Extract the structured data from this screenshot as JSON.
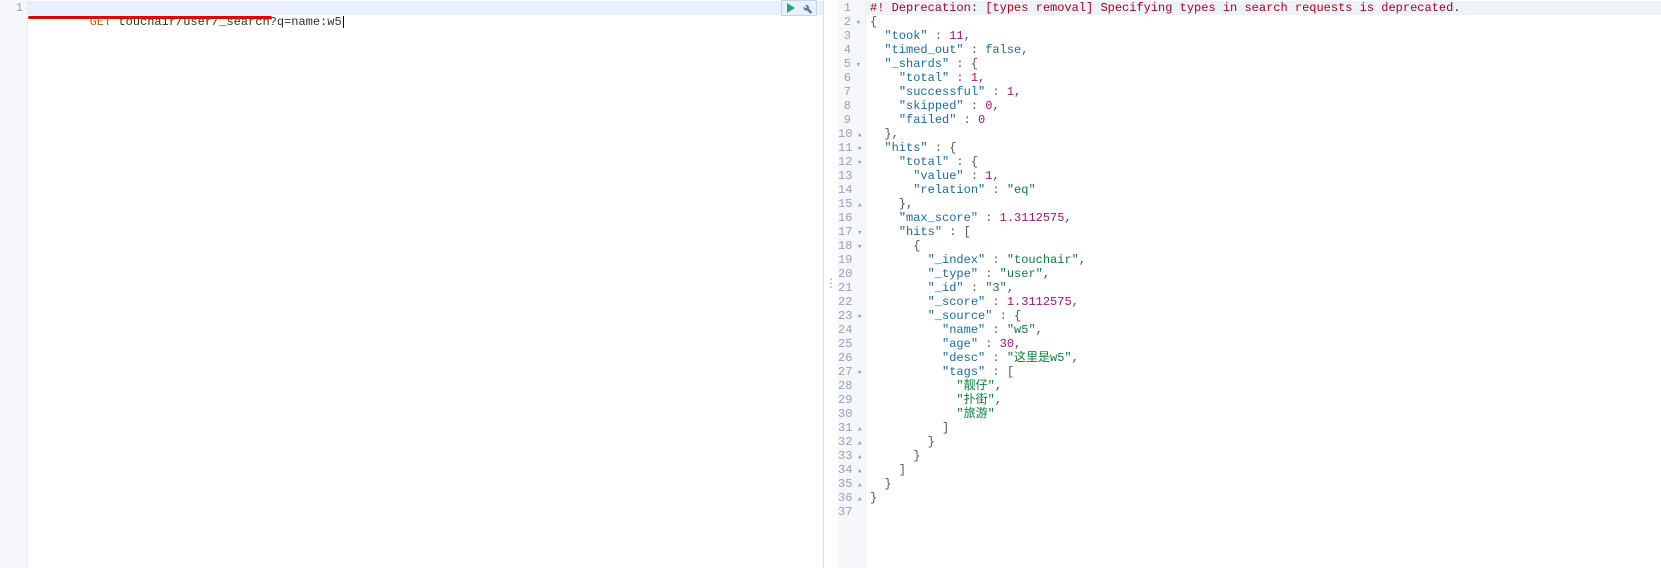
{
  "left": {
    "line_nums": [
      "1"
    ],
    "method": "GET",
    "path": " touchair/user/_search?q=name:w5"
  },
  "divider": "⋮",
  "right": {
    "gutter": [
      {
        "n": "1",
        "f": ""
      },
      {
        "n": "2",
        "f": "▾"
      },
      {
        "n": "3",
        "f": ""
      },
      {
        "n": "4",
        "f": ""
      },
      {
        "n": "5",
        "f": "▾"
      },
      {
        "n": "6",
        "f": ""
      },
      {
        "n": "7",
        "f": ""
      },
      {
        "n": "8",
        "f": ""
      },
      {
        "n": "9",
        "f": ""
      },
      {
        "n": "10",
        "f": "▴"
      },
      {
        "n": "11",
        "f": "▾"
      },
      {
        "n": "12",
        "f": "▾"
      },
      {
        "n": "13",
        "f": ""
      },
      {
        "n": "14",
        "f": ""
      },
      {
        "n": "15",
        "f": "▴"
      },
      {
        "n": "16",
        "f": ""
      },
      {
        "n": "17",
        "f": "▾"
      },
      {
        "n": "18",
        "f": "▾"
      },
      {
        "n": "19",
        "f": ""
      },
      {
        "n": "20",
        "f": ""
      },
      {
        "n": "21",
        "f": ""
      },
      {
        "n": "22",
        "f": ""
      },
      {
        "n": "23",
        "f": "▾"
      },
      {
        "n": "24",
        "f": ""
      },
      {
        "n": "25",
        "f": ""
      },
      {
        "n": "26",
        "f": ""
      },
      {
        "n": "27",
        "f": "▾"
      },
      {
        "n": "28",
        "f": ""
      },
      {
        "n": "29",
        "f": ""
      },
      {
        "n": "30",
        "f": ""
      },
      {
        "n": "31",
        "f": "▴"
      },
      {
        "n": "32",
        "f": "▴"
      },
      {
        "n": "33",
        "f": "▴"
      },
      {
        "n": "34",
        "f": "▴"
      },
      {
        "n": "35",
        "f": "▴"
      },
      {
        "n": "36",
        "f": "▴"
      },
      {
        "n": "37",
        "f": ""
      }
    ],
    "lines": [
      [
        {
          "t": "#! Deprecation: [types removal] Specifying types in search requests is deprecated.",
          "c": "tk-err"
        }
      ],
      [
        {
          "t": "{",
          "c": "tk-punc"
        }
      ],
      [
        {
          "t": "  ",
          "c": ""
        },
        {
          "t": "\"took\"",
          "c": "tk-key"
        },
        {
          "t": " : ",
          "c": "tk-punc"
        },
        {
          "t": "11",
          "c": "tk-num"
        },
        {
          "t": ",",
          "c": "tk-punc"
        }
      ],
      [
        {
          "t": "  ",
          "c": ""
        },
        {
          "t": "\"timed_out\"",
          "c": "tk-key"
        },
        {
          "t": " : ",
          "c": "tk-punc"
        },
        {
          "t": "false",
          "c": "tk-bool"
        },
        {
          "t": ",",
          "c": "tk-punc"
        }
      ],
      [
        {
          "t": "  ",
          "c": ""
        },
        {
          "t": "\"_shards\"",
          "c": "tk-key"
        },
        {
          "t": " : {",
          "c": "tk-punc"
        }
      ],
      [
        {
          "t": "    ",
          "c": ""
        },
        {
          "t": "\"total\"",
          "c": "tk-key"
        },
        {
          "t": " : ",
          "c": "tk-punc"
        },
        {
          "t": "1",
          "c": "tk-num"
        },
        {
          "t": ",",
          "c": "tk-punc"
        }
      ],
      [
        {
          "t": "    ",
          "c": ""
        },
        {
          "t": "\"successful\"",
          "c": "tk-key"
        },
        {
          "t": " : ",
          "c": "tk-punc"
        },
        {
          "t": "1",
          "c": "tk-num"
        },
        {
          "t": ",",
          "c": "tk-punc"
        }
      ],
      [
        {
          "t": "    ",
          "c": ""
        },
        {
          "t": "\"skipped\"",
          "c": "tk-key"
        },
        {
          "t": " : ",
          "c": "tk-punc"
        },
        {
          "t": "0",
          "c": "tk-num"
        },
        {
          "t": ",",
          "c": "tk-punc"
        }
      ],
      [
        {
          "t": "    ",
          "c": ""
        },
        {
          "t": "\"failed\"",
          "c": "tk-key"
        },
        {
          "t": " : ",
          "c": "tk-punc"
        },
        {
          "t": "0",
          "c": "tk-num"
        }
      ],
      [
        {
          "t": "  },",
          "c": "tk-punc"
        }
      ],
      [
        {
          "t": "  ",
          "c": ""
        },
        {
          "t": "\"hits\"",
          "c": "tk-key"
        },
        {
          "t": " : {",
          "c": "tk-punc"
        }
      ],
      [
        {
          "t": "    ",
          "c": ""
        },
        {
          "t": "\"total\"",
          "c": "tk-key"
        },
        {
          "t": " : {",
          "c": "tk-punc"
        }
      ],
      [
        {
          "t": "      ",
          "c": ""
        },
        {
          "t": "\"value\"",
          "c": "tk-key"
        },
        {
          "t": " : ",
          "c": "tk-punc"
        },
        {
          "t": "1",
          "c": "tk-num"
        },
        {
          "t": ",",
          "c": "tk-punc"
        }
      ],
      [
        {
          "t": "      ",
          "c": ""
        },
        {
          "t": "\"relation\"",
          "c": "tk-key"
        },
        {
          "t": " : ",
          "c": "tk-punc"
        },
        {
          "t": "\"eq\"",
          "c": "tk-str"
        }
      ],
      [
        {
          "t": "    },",
          "c": "tk-punc"
        }
      ],
      [
        {
          "t": "    ",
          "c": ""
        },
        {
          "t": "\"max_score\"",
          "c": "tk-key"
        },
        {
          "t": " : ",
          "c": "tk-punc"
        },
        {
          "t": "1.3112575",
          "c": "tk-num"
        },
        {
          "t": ",",
          "c": "tk-punc"
        }
      ],
      [
        {
          "t": "    ",
          "c": ""
        },
        {
          "t": "\"hits\"",
          "c": "tk-key"
        },
        {
          "t": " : [",
          "c": "tk-punc"
        }
      ],
      [
        {
          "t": "      {",
          "c": "tk-punc"
        }
      ],
      [
        {
          "t": "        ",
          "c": ""
        },
        {
          "t": "\"_index\"",
          "c": "tk-key"
        },
        {
          "t": " : ",
          "c": "tk-punc"
        },
        {
          "t": "\"touchair\"",
          "c": "tk-str"
        },
        {
          "t": ",",
          "c": "tk-punc"
        }
      ],
      [
        {
          "t": "        ",
          "c": ""
        },
        {
          "t": "\"_type\"",
          "c": "tk-key"
        },
        {
          "t": " : ",
          "c": "tk-punc"
        },
        {
          "t": "\"user\"",
          "c": "tk-str"
        },
        {
          "t": ",",
          "c": "tk-punc"
        }
      ],
      [
        {
          "t": "        ",
          "c": ""
        },
        {
          "t": "\"_id\"",
          "c": "tk-key"
        },
        {
          "t": " : ",
          "c": "tk-punc"
        },
        {
          "t": "\"3\"",
          "c": "tk-str"
        },
        {
          "t": ",",
          "c": "tk-punc"
        }
      ],
      [
        {
          "t": "        ",
          "c": ""
        },
        {
          "t": "\"_score\"",
          "c": "tk-key"
        },
        {
          "t": " : ",
          "c": "tk-punc"
        },
        {
          "t": "1.3112575",
          "c": "tk-num"
        },
        {
          "t": ",",
          "c": "tk-punc"
        }
      ],
      [
        {
          "t": "        ",
          "c": ""
        },
        {
          "t": "\"_source\"",
          "c": "tk-key"
        },
        {
          "t": " : {",
          "c": "tk-punc"
        }
      ],
      [
        {
          "t": "          ",
          "c": ""
        },
        {
          "t": "\"name\"",
          "c": "tk-key"
        },
        {
          "t": " : ",
          "c": "tk-punc"
        },
        {
          "t": "\"w5\"",
          "c": "tk-str"
        },
        {
          "t": ",",
          "c": "tk-punc"
        }
      ],
      [
        {
          "t": "          ",
          "c": ""
        },
        {
          "t": "\"age\"",
          "c": "tk-key"
        },
        {
          "t": " : ",
          "c": "tk-punc"
        },
        {
          "t": "30",
          "c": "tk-num"
        },
        {
          "t": ",",
          "c": "tk-punc"
        }
      ],
      [
        {
          "t": "          ",
          "c": ""
        },
        {
          "t": "\"desc\"",
          "c": "tk-key"
        },
        {
          "t": " : ",
          "c": "tk-punc"
        },
        {
          "t": "\"这里是w5\"",
          "c": "tk-str"
        },
        {
          "t": ",",
          "c": "tk-punc"
        }
      ],
      [
        {
          "t": "          ",
          "c": ""
        },
        {
          "t": "\"tags\"",
          "c": "tk-key"
        },
        {
          "t": " : [",
          "c": "tk-punc"
        }
      ],
      [
        {
          "t": "            ",
          "c": ""
        },
        {
          "t": "\"靓仔\"",
          "c": "tk-str"
        },
        {
          "t": ",",
          "c": "tk-punc"
        }
      ],
      [
        {
          "t": "            ",
          "c": ""
        },
        {
          "t": "\"扑街\"",
          "c": "tk-str"
        },
        {
          "t": ",",
          "c": "tk-punc"
        }
      ],
      [
        {
          "t": "            ",
          "c": ""
        },
        {
          "t": "\"旅游\"",
          "c": "tk-str"
        }
      ],
      [
        {
          "t": "          ]",
          "c": "tk-punc"
        }
      ],
      [
        {
          "t": "        }",
          "c": "tk-punc"
        }
      ],
      [
        {
          "t": "      }",
          "c": "tk-punc"
        }
      ],
      [
        {
          "t": "    ]",
          "c": "tk-punc"
        }
      ],
      [
        {
          "t": "  }",
          "c": "tk-punc"
        }
      ],
      [
        {
          "t": "}",
          "c": "tk-punc"
        }
      ],
      [
        {
          "t": "",
          "c": ""
        }
      ]
    ]
  }
}
